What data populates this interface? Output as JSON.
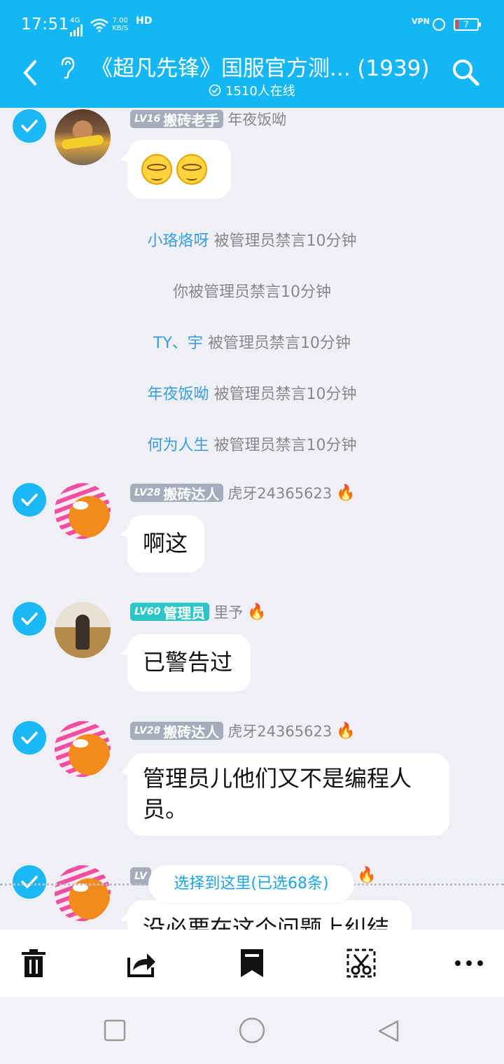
{
  "status_bar": {
    "time": "17:51",
    "network": "4G",
    "speed_value": "7.00",
    "speed_unit": "KB/S",
    "hd": "HD",
    "vpn": "VPN",
    "battery": "7"
  },
  "header": {
    "title": "《超凡先锋》国服官方测...",
    "count": "(1939)",
    "online": "1510人在线"
  },
  "messages": [
    {
      "level": "LV16",
      "rank": "搬砖老手",
      "name": "年夜饭呦",
      "emoji": [
        "grin-squint-emoji",
        "grin-squint-emoji"
      ]
    },
    {
      "level": "LV28",
      "rank": "搬砖达人",
      "name": "虎牙24365623",
      "text": "啊这"
    },
    {
      "level": "LV60",
      "rank": "管理员",
      "name": "里予",
      "text": "已警告过"
    },
    {
      "level": "LV28",
      "rank": "搬砖达人",
      "name": "虎牙24365623",
      "text": "管理员儿他们又不是编程人员。"
    },
    {
      "level": "LV",
      "text": "没必要在这个问题上纠结"
    }
  ],
  "system_notices": [
    {
      "name": "小珞烙呀",
      "action": "被管理员禁言10分钟"
    },
    {
      "name": "",
      "action": "你被管理员禁言10分钟"
    },
    {
      "name": "TY、宇",
      "action": "被管理员禁言10分钟"
    },
    {
      "name": "年夜饭呦",
      "action": "被管理员禁言10分钟"
    },
    {
      "name": "何为人生",
      "action": "被管理员禁言10分钟"
    }
  ],
  "select_pill": "选择到这里(已选68条)",
  "toolbar": [
    "trash-icon",
    "share-icon",
    "bookmark-icon",
    "screenshot-scissors-icon",
    "more-icon"
  ],
  "colors": {
    "accent": "#14b7f6",
    "link": "#3a9de0",
    "admin_badge": "#2cc6c8",
    "level_badge": "#a6acbc",
    "fire": "#f25c1a"
  }
}
